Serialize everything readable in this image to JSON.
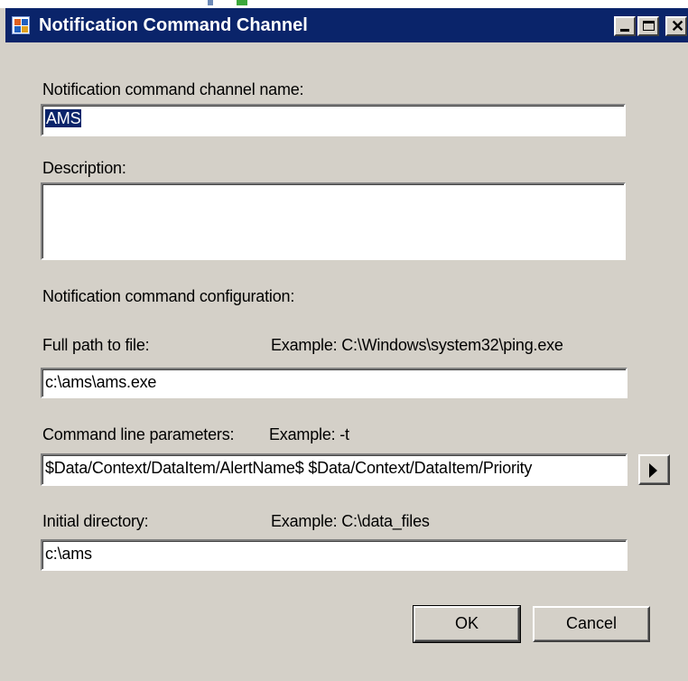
{
  "window": {
    "title": "Notification Command Channel",
    "icon": "app-window-icon",
    "controls": [
      "minimize-icon",
      "maximize-icon",
      "close-icon"
    ]
  },
  "form": {
    "name_label": "Notification command channel name:",
    "name_value": "AMS",
    "description_label": "Description:",
    "description_value": "",
    "section_label": "Notification command configuration:",
    "path_label": "Full path to file:",
    "path_example": "Example: C:\\Windows\\system32\\ping.exe",
    "path_value": "c:\\ams\\ams.exe",
    "params_label": "Command line parameters:",
    "params_example": "Example: -t",
    "params_value": "$Data/Context/DataItem/AlertName$ $Data/Context/DataItem/Priority",
    "insert_button_icon": "arrow-right-icon",
    "dir_label": "Initial directory:",
    "dir_example": "Example: C:\\data_files",
    "dir_value": "c:\\ams"
  },
  "buttons": {
    "ok": "OK",
    "cancel": "Cancel"
  },
  "colors": {
    "titlebar": "#0a246a",
    "dialog_bg": "#d4d0c8",
    "selection": "#0a246a"
  }
}
